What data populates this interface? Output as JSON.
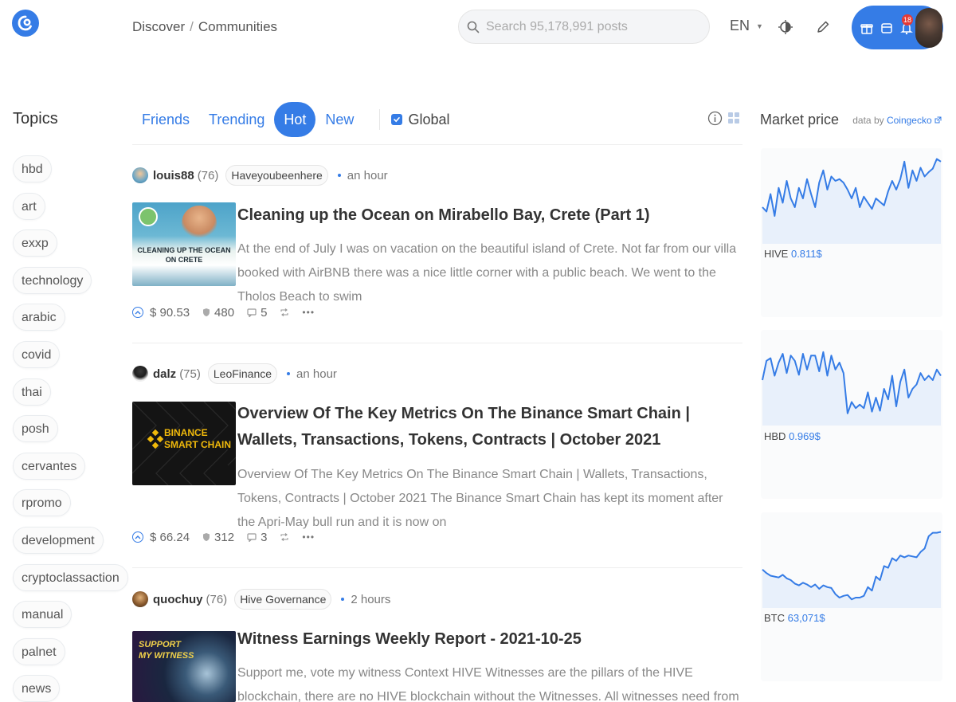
{
  "header": {
    "breadcrumb": [
      "Discover",
      "Communities"
    ],
    "breadcrumb_sep": "/",
    "search_placeholder": "Search 95,178,991 posts",
    "language": "EN",
    "notification_count": "18"
  },
  "topics": {
    "title": "Topics",
    "items": [
      "hbd",
      "art",
      "exxp",
      "technology",
      "arabic",
      "covid",
      "thai",
      "posh",
      "cervantes",
      "rpromo",
      "development",
      "cryptoclassaction",
      "manual",
      "palnet",
      "news"
    ]
  },
  "feed": {
    "tabs": [
      "Friends",
      "Trending",
      "Hot",
      "New"
    ],
    "active_tab": "Hot",
    "global_label": "Global",
    "global_checked": true,
    "posts": [
      {
        "author": "louis88",
        "reputation": "(76)",
        "community": "Haveyoubeenhere",
        "time": "an hour",
        "title": "Cleaning up the Ocean on Mirabello Bay, Crete (Part 1)",
        "body": "At the end of July I was on vacation on the beautiful island of Crete. Not far from our villa booked with AirBNB there was a nice little corner with a public beach. We went to the Tholos Beach to swim",
        "thumb_text": [
          "CLEANING UP THE OCEAN",
          "ON CRETE"
        ],
        "payout": "$ 90.53",
        "votes": "480",
        "comments": "5"
      },
      {
        "author": "dalz",
        "reputation": "(75)",
        "community": "LeoFinance",
        "time": "an hour",
        "title": "Overview Of The Key Metrics On The Binance Smart Chain | Wallets, Transactions, Tokens, Contracts | October 2021",
        "body": "Overview Of The Key Metrics On The Binance Smart Chain | Wallets, Transactions, Tokens, Contracts | October 2021 The Binance Smart Chain has kept its moment after the Apri-May bull run and it is now on",
        "thumb_text": [
          "BINANCE",
          "SMART CHAIN"
        ],
        "payout": "$ 66.24",
        "votes": "312",
        "comments": "3"
      },
      {
        "author": "quochuy",
        "reputation": "(76)",
        "community": "Hive Governance",
        "time": "2 hours",
        "title": "Witness Earnings Weekly Report - 2021-10-25",
        "body": "Support me, vote my witness Context HIVE Witnesses are the pillars of the HIVE blockchain, there are no HIVE blockchain without the Witnesses. All witnesses need from you is a witness vote that costs you",
        "thumb_text": [
          "SUPPORT",
          "MY WITNESS"
        ]
      }
    ]
  },
  "market": {
    "title": "Market price",
    "source_prefix": "data by ",
    "source_link": "Coingecko",
    "accent": "#357ce6",
    "coins": [
      {
        "symbol": "HIVE",
        "price": "0.811$",
        "values": [
          0.4,
          0.35,
          0.55,
          0.3,
          0.62,
          0.45,
          0.7,
          0.5,
          0.4,
          0.62,
          0.5,
          0.72,
          0.55,
          0.4,
          0.68,
          0.82,
          0.6,
          0.75,
          0.7,
          0.72,
          0.68,
          0.6,
          0.5,
          0.62,
          0.4,
          0.52,
          0.45,
          0.38,
          0.5,
          0.46,
          0.42,
          0.58,
          0.7,
          0.6,
          0.72,
          0.92,
          0.62,
          0.82,
          0.7,
          0.85,
          0.75,
          0.8,
          0.84,
          0.95,
          0.92
        ]
      },
      {
        "symbol": "HBD",
        "price": "0.969$",
        "values": [
          0.5,
          0.72,
          0.75,
          0.55,
          0.7,
          0.8,
          0.58,
          0.78,
          0.72,
          0.56,
          0.8,
          0.62,
          0.78,
          0.78,
          0.6,
          0.82,
          0.55,
          0.78,
          0.62,
          0.7,
          0.58,
          0.12,
          0.25,
          0.18,
          0.22,
          0.18,
          0.36,
          0.14,
          0.3,
          0.15,
          0.4,
          0.28,
          0.55,
          0.2,
          0.48,
          0.62,
          0.3,
          0.4,
          0.45,
          0.58,
          0.5,
          0.55,
          0.5,
          0.62,
          0.55
        ]
      },
      {
        "symbol": "BTC",
        "price": "63,071$",
        "values": [
          0.42,
          0.38,
          0.35,
          0.34,
          0.33,
          0.36,
          0.32,
          0.3,
          0.26,
          0.24,
          0.27,
          0.25,
          0.22,
          0.25,
          0.2,
          0.24,
          0.22,
          0.21,
          0.14,
          0.1,
          0.12,
          0.13,
          0.08,
          0.1,
          0.1,
          0.12,
          0.22,
          0.18,
          0.34,
          0.3,
          0.46,
          0.44,
          0.55,
          0.52,
          0.58,
          0.56,
          0.58,
          0.57,
          0.56,
          0.62,
          0.66,
          0.8,
          0.84,
          0.84,
          0.85
        ]
      }
    ]
  }
}
